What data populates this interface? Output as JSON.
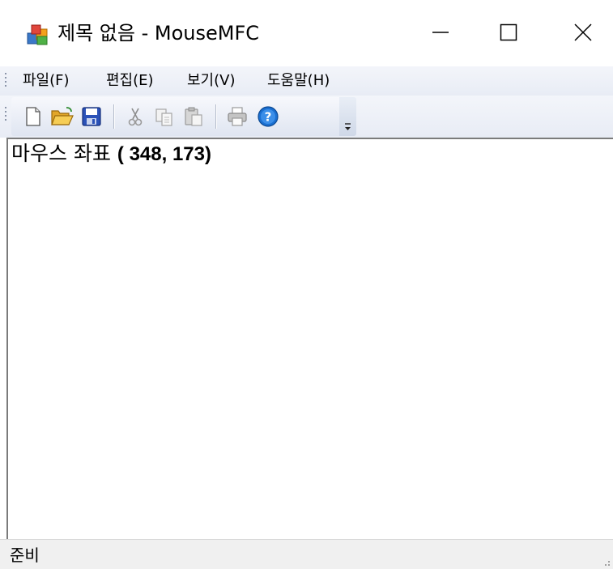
{
  "window": {
    "title": "제목 없음 - MouseMFC",
    "icon": "mfc-app-icon"
  },
  "menubar": {
    "items": [
      {
        "label": "파일(F)"
      },
      {
        "label": "편집(E)"
      },
      {
        "label": "보기(V)"
      },
      {
        "label": "도움말(H)"
      }
    ]
  },
  "toolbar": {
    "buttons": [
      {
        "icon": "new-document-icon"
      },
      {
        "icon": "open-folder-icon"
      },
      {
        "icon": "save-icon"
      },
      {
        "icon": "cut-icon"
      },
      {
        "icon": "copy-icon"
      },
      {
        "icon": "paste-icon"
      },
      {
        "icon": "print-icon"
      },
      {
        "icon": "help-icon"
      }
    ]
  },
  "content": {
    "coord_label": "마우스 좌표",
    "coord_value": "( 348,  173)"
  },
  "statusbar": {
    "text": "준비"
  },
  "colors": {
    "bar_light": "#f3f5fa",
    "bar_dark": "#e8ecf5",
    "help_blue": "#1a6fd1",
    "save_blue": "#2b52b8",
    "folder_yellow": "#f0c040"
  }
}
